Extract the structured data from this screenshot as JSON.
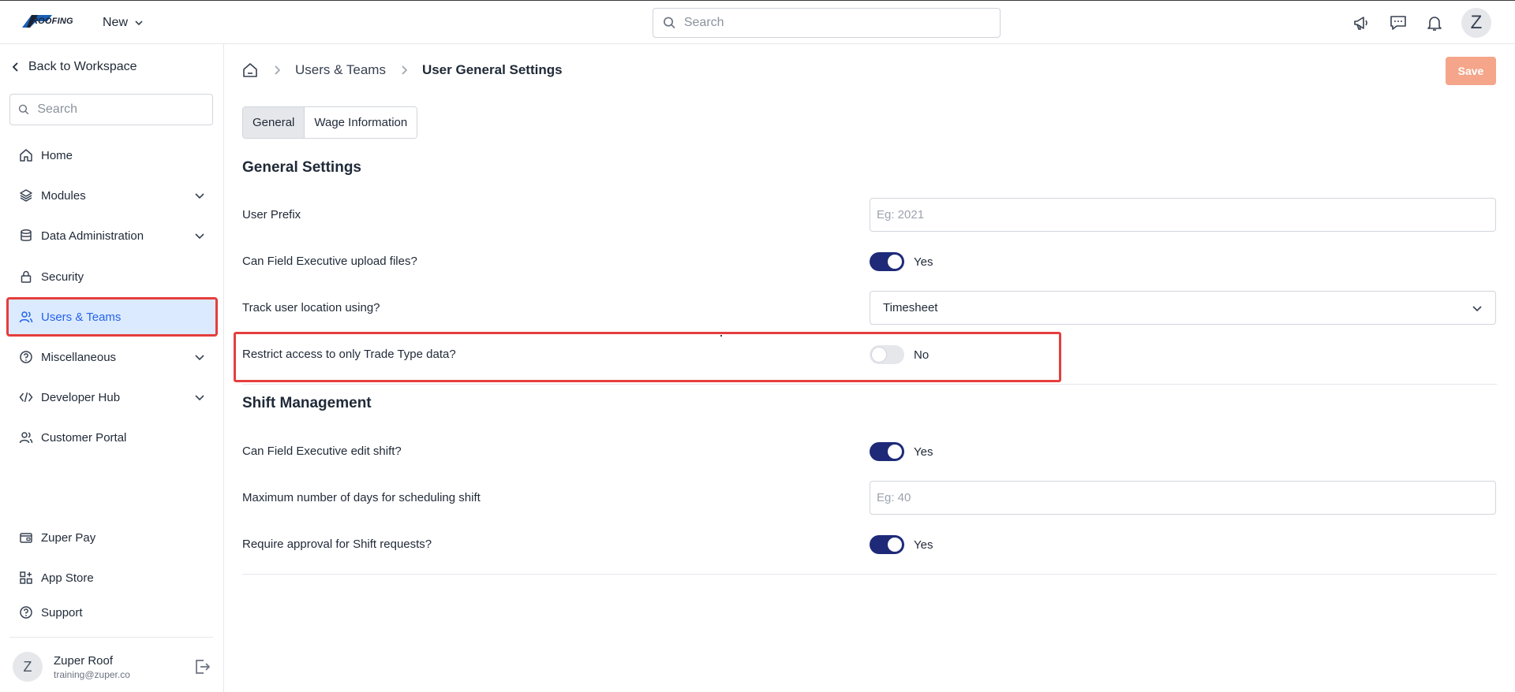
{
  "header": {
    "logo_text": "ROOFING",
    "new_label": "New",
    "search_placeholder": "Search",
    "avatar_initial": "Z",
    "icons": [
      "megaphone-icon",
      "chat-icon",
      "bell-icon"
    ]
  },
  "sidebar": {
    "back_label": "Back to Workspace",
    "search_placeholder": "Search",
    "items": [
      {
        "label": "Home",
        "icon": "home-icon",
        "expandable": false
      },
      {
        "label": "Modules",
        "icon": "layers-icon",
        "expandable": true
      },
      {
        "label": "Data Administration",
        "icon": "database-icon",
        "expandable": true
      },
      {
        "label": "Security",
        "icon": "lock-icon",
        "expandable": false
      },
      {
        "label": "Users & Teams",
        "icon": "users-icon",
        "expandable": false,
        "active": true
      },
      {
        "label": "Miscellaneous",
        "icon": "help-circle-icon",
        "expandable": true
      },
      {
        "label": "Developer Hub",
        "icon": "code-icon",
        "expandable": true
      },
      {
        "label": "Customer Portal",
        "icon": "users-icon",
        "expandable": false
      }
    ],
    "bottom_items": [
      {
        "label": "Zuper Pay",
        "icon": "wallet-icon"
      },
      {
        "label": "App Store",
        "icon": "apps-icon"
      },
      {
        "label": "Support",
        "icon": "help-circle-icon"
      }
    ],
    "user": {
      "initial": "Z",
      "name": "Zuper Roof",
      "email": "training@zuper.co"
    }
  },
  "breadcrumb": [
    "Users & Teams",
    "User General Settings"
  ],
  "save_label": "Save",
  "tabs": [
    "General",
    "Wage Information"
  ],
  "general_settings": {
    "title": "General Settings",
    "user_prefix": {
      "label": "User Prefix",
      "placeholder": "Eg: 2021",
      "value": ""
    },
    "upload_files": {
      "label": "Can Field Executive upload files?",
      "state": "Yes"
    },
    "track_location": {
      "label": "Track user location using?",
      "value": "Timesheet"
    },
    "restrict_access": {
      "label": "Restrict access to only Trade Type data?",
      "state": "No"
    }
  },
  "shift_management": {
    "title": "Shift Management",
    "edit_shift": {
      "label": "Can Field Executive edit shift?",
      "state": "Yes"
    },
    "max_days": {
      "label": "Maximum number of days for scheduling shift",
      "placeholder": "Eg: 40",
      "value": ""
    },
    "require_approval": {
      "label": "Require approval for Shift requests?",
      "state": "Yes"
    }
  },
  "colors": {
    "accent": "#1e2a78",
    "active_nav_bg": "#dbeafe",
    "active_nav_text": "#2563eb",
    "highlight": "#e53e3e",
    "save_button": "#f4a58a"
  }
}
